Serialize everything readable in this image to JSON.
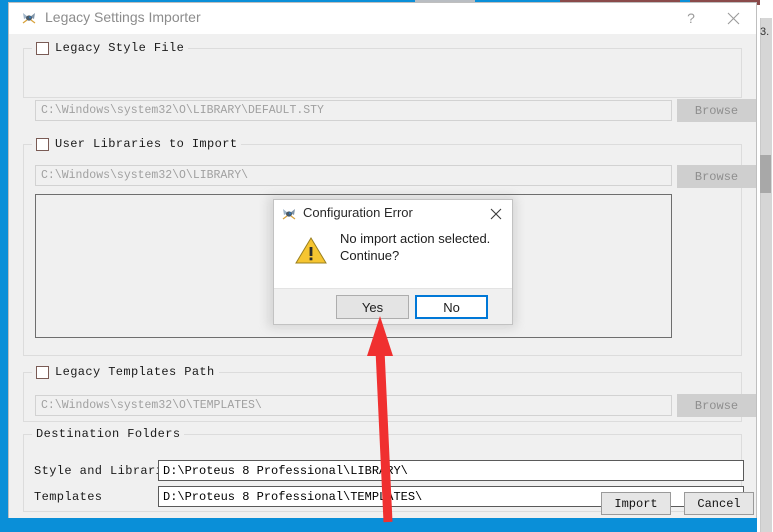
{
  "window": {
    "title": "Legacy Settings Importer",
    "icon": "proteus-logo-icon",
    "help_label": "?",
    "close_label": "✕"
  },
  "sections": {
    "legacy_style_file": {
      "checkbox_label": "Legacy Style File",
      "checked": false,
      "path_value": "C:\\Windows\\system32\\O\\LIBRARY\\DEFAULT.STY",
      "browse_label": "Browse",
      "browse_enabled": false
    },
    "user_libraries": {
      "checkbox_label": "User Libraries to Import",
      "checked": false,
      "path_value": "C:\\Windows\\system32\\O\\LIBRARY\\",
      "browse_label": "Browse",
      "browse_enabled": false,
      "list_items": []
    },
    "legacy_templates_path": {
      "checkbox_label": "Legacy Templates Path",
      "checked": false,
      "path_value": "C:\\Windows\\system32\\O\\TEMPLATES\\",
      "browse_label": "Browse",
      "browse_enabled": false
    },
    "destination_folders": {
      "legend": "Destination Folders",
      "rows": [
        {
          "label": "Style and Libraries",
          "value": "D:\\Proteus 8 Professional\\LIBRARY\\"
        },
        {
          "label": "Templates",
          "value": "D:\\Proteus 8 Professional\\TEMPLATES\\"
        }
      ]
    }
  },
  "footer": {
    "import_label": "Import",
    "cancel_label": "Cancel"
  },
  "dialog": {
    "title": "Configuration Error",
    "icon": "proteus-logo-icon",
    "close_label": "✕",
    "warning_icon": "warning-triangle-icon",
    "message": "No import action selected. Continue?",
    "buttons": {
      "yes_label": "Yes",
      "no_label": "No"
    }
  },
  "annotation": {
    "arrow_color": "#f03030",
    "points_at": "Yes"
  },
  "background": {
    "desktop_color": "#0a8fd8",
    "fragment_text": "3."
  },
  "colors": {
    "accent_focus": "#0078d7",
    "warning": "#f5c518",
    "window_bg": "#f0f0f0"
  }
}
